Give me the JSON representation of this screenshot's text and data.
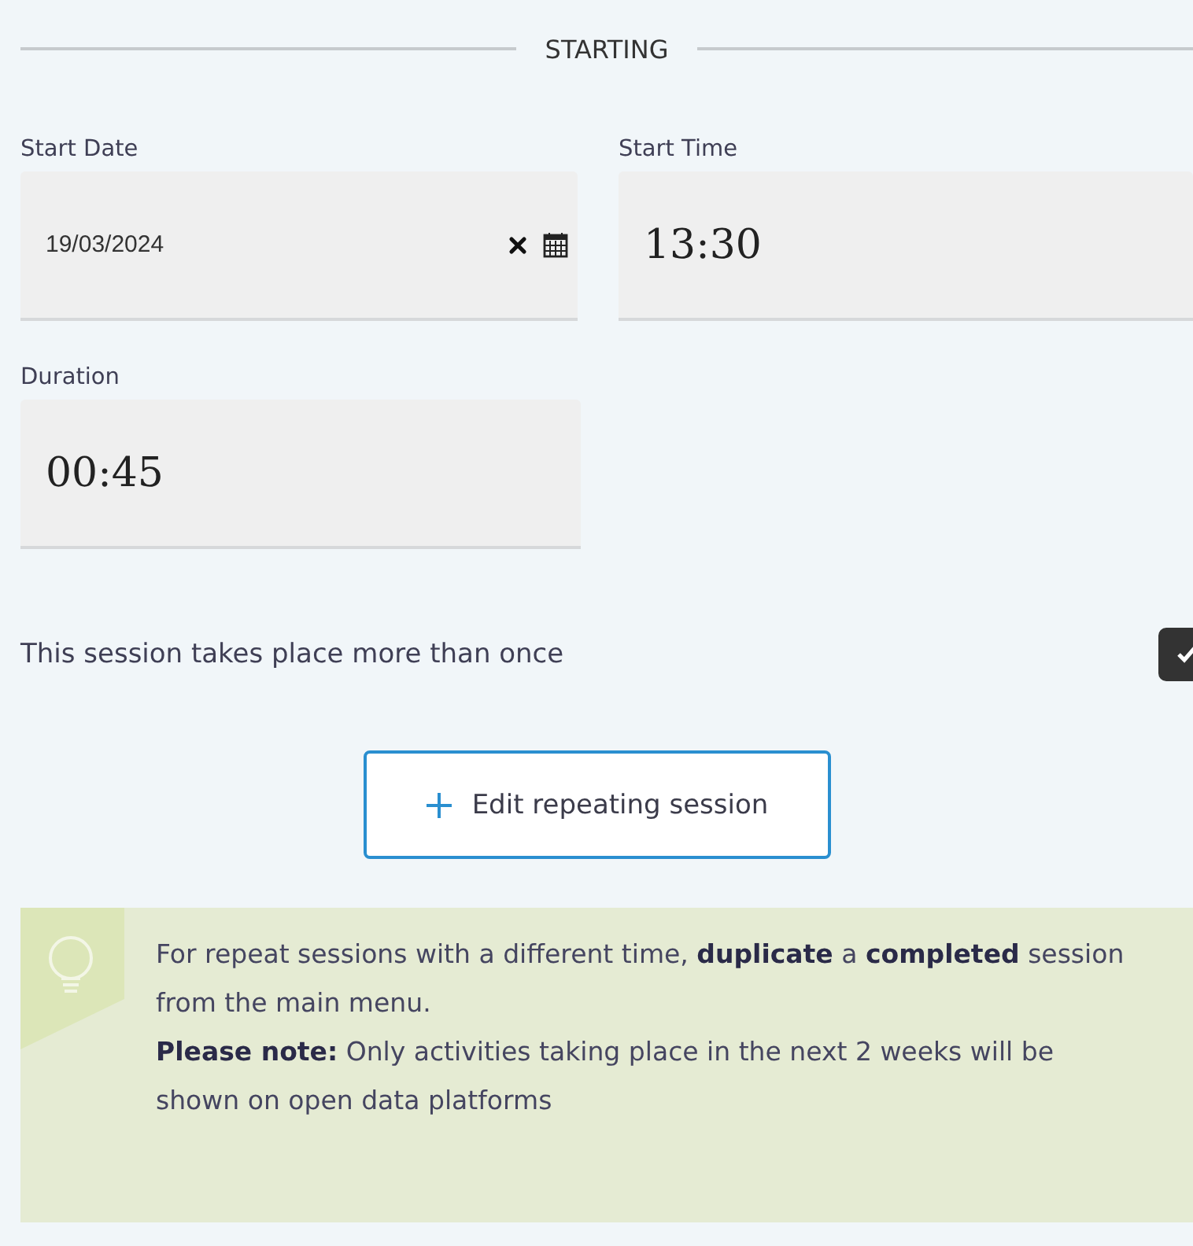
{
  "section": {
    "title": "STARTING"
  },
  "fields": [
    {
      "label": "Start Date",
      "value": "19/03/2024",
      "kind": "date"
    },
    {
      "label": "Start Time",
      "value": "13:30",
      "kind": "time"
    },
    {
      "label": "Duration",
      "value": "00:45",
      "kind": "time"
    }
  ],
  "repeat": {
    "label": "This session takes place more than once",
    "checked": true
  },
  "edit_button": {
    "label": "Edit repeating session"
  },
  "info": {
    "lines": [
      "For repeat sessions with a different time, **duplicate** a **completed** session from the main menu.",
      "**Please note:** Only activities taking place in the next 2 weeks will be shown on open data platforms"
    ]
  }
}
